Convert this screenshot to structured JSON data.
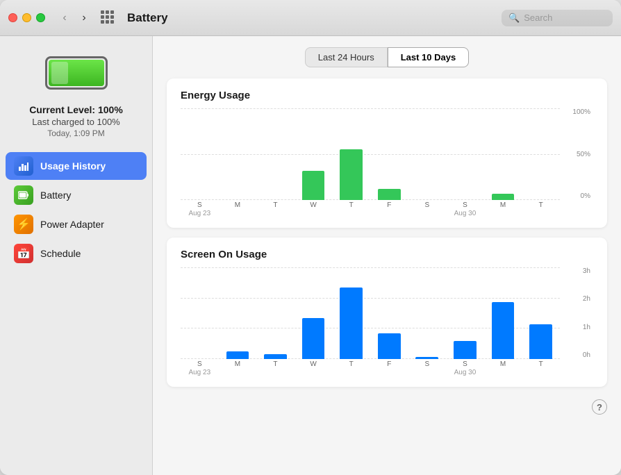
{
  "window": {
    "title": "Battery"
  },
  "titlebar": {
    "back_label": "‹",
    "forward_label": "›",
    "search_placeholder": "Search"
  },
  "sidebar": {
    "battery_level_label": "Current Level: 100%",
    "battery_charged_label": "Last charged to 100%",
    "battery_time_label": "Today, 1:09 PM",
    "nav_items": [
      {
        "id": "usage-history",
        "label": "Usage History",
        "icon": "📊",
        "icon_class": "icon-usage",
        "active": true
      },
      {
        "id": "battery",
        "label": "Battery",
        "icon": "🔋",
        "icon_class": "icon-battery",
        "active": false
      },
      {
        "id": "power-adapter",
        "label": "Power Adapter",
        "icon": "⚡",
        "icon_class": "icon-power",
        "active": false
      },
      {
        "id": "schedule",
        "label": "Schedule",
        "icon": "📅",
        "icon_class": "icon-schedule",
        "active": false
      }
    ]
  },
  "tabs": [
    {
      "id": "24h",
      "label": "Last 24 Hours",
      "active": false
    },
    {
      "id": "10d",
      "label": "Last 10 Days",
      "active": true
    }
  ],
  "energy_chart": {
    "title": "Energy Usage",
    "y_labels": [
      "100%",
      "50%",
      "0%"
    ],
    "bars": [
      {
        "day": "S",
        "date": "Aug 23",
        "show_date": true,
        "height_pct": 0
      },
      {
        "day": "M",
        "date": "",
        "show_date": false,
        "height_pct": 0
      },
      {
        "day": "T",
        "date": "",
        "show_date": false,
        "height_pct": 0
      },
      {
        "day": "W",
        "date": "",
        "show_date": false,
        "height_pct": 32
      },
      {
        "day": "T",
        "date": "",
        "show_date": false,
        "height_pct": 55
      },
      {
        "day": "F",
        "date": "",
        "show_date": false,
        "height_pct": 12
      },
      {
        "day": "S",
        "date": "",
        "show_date": false,
        "height_pct": 0
      },
      {
        "day": "S",
        "date": "Aug 30",
        "show_date": true,
        "height_pct": 0
      },
      {
        "day": "M",
        "date": "",
        "show_date": false,
        "height_pct": 7
      },
      {
        "day": "T",
        "date": "",
        "show_date": false,
        "height_pct": 0
      }
    ]
  },
  "screen_chart": {
    "title": "Screen On Usage",
    "y_labels": [
      "3h",
      "2h",
      "1h",
      "0h"
    ],
    "bars": [
      {
        "day": "S",
        "date": "Aug 23",
        "show_date": true,
        "height_pct": 0
      },
      {
        "day": "M",
        "date": "",
        "show_date": false,
        "height_pct": 8
      },
      {
        "day": "T",
        "date": "",
        "show_date": false,
        "height_pct": 5
      },
      {
        "day": "W",
        "date": "",
        "show_date": false,
        "height_pct": 45
      },
      {
        "day": "T",
        "date": "",
        "show_date": false,
        "height_pct": 78
      },
      {
        "day": "F",
        "date": "",
        "show_date": false,
        "height_pct": 28
      },
      {
        "day": "S",
        "date": "",
        "show_date": false,
        "height_pct": 2
      },
      {
        "day": "S",
        "date": "Aug 30",
        "show_date": true,
        "height_pct": 20
      },
      {
        "day": "M",
        "date": "",
        "show_date": false,
        "height_pct": 62
      },
      {
        "day": "T",
        "date": "",
        "show_date": false,
        "height_pct": 38
      }
    ]
  },
  "help_btn_label": "?"
}
